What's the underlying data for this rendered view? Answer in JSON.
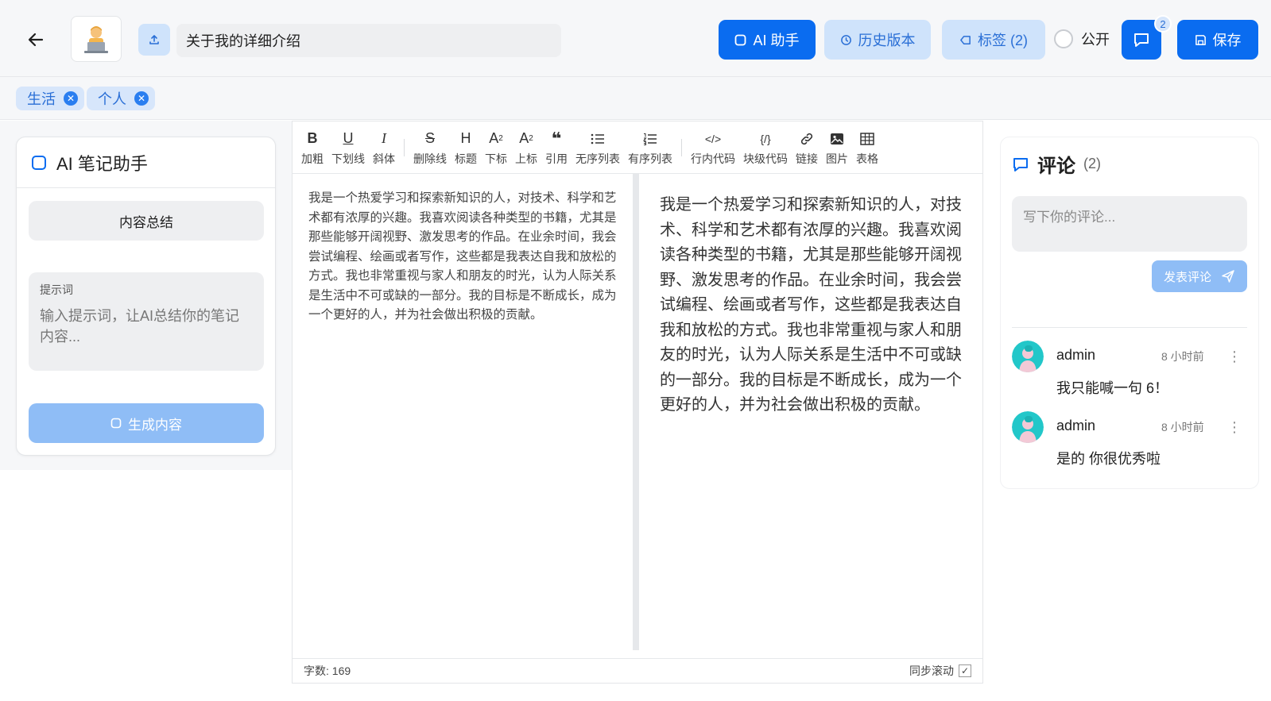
{
  "header": {
    "title_value": "关于我的详细介绍",
    "ai_button": "AI 助手",
    "history_button": "历史版本",
    "tags_button": "标签 (2)",
    "public_label": "公开",
    "comment_badge": "2",
    "save_button": "保存"
  },
  "tags": [
    {
      "label": "生活"
    },
    {
      "label": "个人"
    }
  ],
  "ai_panel": {
    "title": "AI 笔记助手",
    "summary_button": "内容总结",
    "prompt_label": "提示词",
    "prompt_placeholder": "输入提示词，让AI总结你的笔记内容...",
    "generate_button": "生成内容"
  },
  "toolbar": {
    "bold": "加粗",
    "underline": "下划线",
    "italic": "斜体",
    "strike": "删除线",
    "heading": "标题",
    "subscript": "下标",
    "superscript": "上标",
    "quote": "引用",
    "unordered_list": "无序列表",
    "ordered_list": "有序列表",
    "inline_code": "行内代码",
    "code_block": "块级代码",
    "link": "链接",
    "image": "图片",
    "table": "表格"
  },
  "editor": {
    "content": "我是一个热爱学习和探索新知识的人，对技术、科学和艺术都有浓厚的兴趣。我喜欢阅读各种类型的书籍，尤其是那些能够开阔视野、激发思考的作品。在业余时间，我会尝试编程、绘画或者写作，这些都是我表达自我和放松的方式。我也非常重视与家人和朋友的时光，认为人际关系是生活中不可或缺的一部分。我的目标是不断成长，成为一个更好的人，并为社会做出积极的贡献。",
    "word_count": "字数: 169",
    "sync_scroll": "同步滚动",
    "sync_check": "✓"
  },
  "comments": {
    "title": "评论",
    "count": "(2)",
    "placeholder": "写下你的评论...",
    "post_button": "发表评论",
    "items": [
      {
        "user": "admin",
        "time": "8 小时前",
        "text": "我只能喊一句 6！"
      },
      {
        "user": "admin",
        "time": "8 小时前",
        "text": "是的 你很优秀啦"
      }
    ]
  },
  "colors": {
    "primary": "#0a6cf0",
    "light_primary": "#cfe3fb",
    "disabled_primary": "#8fbdf6"
  }
}
